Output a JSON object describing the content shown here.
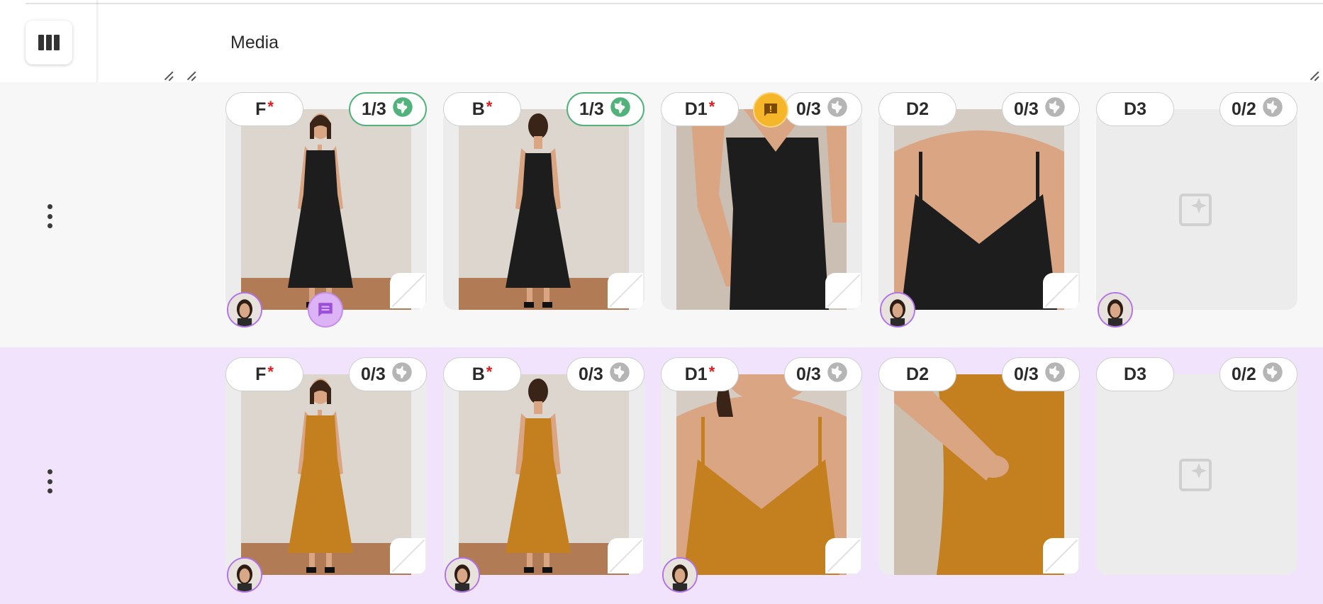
{
  "header": {
    "title": "Media"
  },
  "icons": {
    "columns": "view-columns-icon",
    "globe": "globe-icon",
    "more": "more-vertical-icon",
    "add_media": "add-photo-sparkle-icon",
    "comment": "comment-icon",
    "alert": "alert-icon"
  },
  "colors": {
    "accent_purple": "#b173e5",
    "published_green": "#52b27b",
    "required_red": "#e21b1b",
    "alert_yellow": "#f5b62a",
    "row_selected": "#f1e3fb",
    "black_dress": "#1d1d1d",
    "ochre_dress": "#c4801f"
  },
  "rows": [
    {
      "variant": "black",
      "selected": false,
      "tiles": [
        {
          "label": "F",
          "required": true,
          "count": "1/3",
          "published": true,
          "has_image": true,
          "image": "black-dress-front",
          "avatar": true,
          "comment": true,
          "alert": false
        },
        {
          "label": "B",
          "required": true,
          "count": "1/3",
          "published": true,
          "has_image": true,
          "image": "black-dress-back",
          "avatar": false,
          "comment": false,
          "alert": false
        },
        {
          "label": "D1",
          "required": true,
          "count": "0/3",
          "published": false,
          "has_image": true,
          "image": "black-dress-detail-waist",
          "avatar": false,
          "comment": false,
          "alert": true
        },
        {
          "label": "D2",
          "required": false,
          "count": "0/3",
          "published": false,
          "has_image": true,
          "image": "black-dress-detail-neckline",
          "avatar": true,
          "comment": false,
          "alert": false
        },
        {
          "label": "D3",
          "required": false,
          "count": "0/2",
          "published": false,
          "has_image": false,
          "image": "",
          "avatar": true,
          "comment": false,
          "alert": false
        }
      ]
    },
    {
      "variant": "ochre",
      "selected": true,
      "tiles": [
        {
          "label": "F",
          "required": true,
          "count": "0/3",
          "published": false,
          "has_image": true,
          "image": "ochre-dress-front",
          "avatar": true,
          "comment": false,
          "alert": false
        },
        {
          "label": "B",
          "required": true,
          "count": "0/3",
          "published": false,
          "has_image": true,
          "image": "ochre-dress-back",
          "avatar": true,
          "comment": false,
          "alert": false
        },
        {
          "label": "D1",
          "required": true,
          "count": "0/3",
          "published": false,
          "has_image": true,
          "image": "ochre-dress-detail-neckline",
          "avatar": true,
          "comment": false,
          "alert": false
        },
        {
          "label": "D2",
          "required": false,
          "count": "0/3",
          "published": false,
          "has_image": true,
          "image": "ochre-dress-detail-pocket",
          "avatar": false,
          "comment": false,
          "alert": false
        },
        {
          "label": "D3",
          "required": false,
          "count": "0/2",
          "published": false,
          "has_image": false,
          "image": "",
          "avatar": false,
          "comment": false,
          "alert": false
        }
      ]
    }
  ]
}
